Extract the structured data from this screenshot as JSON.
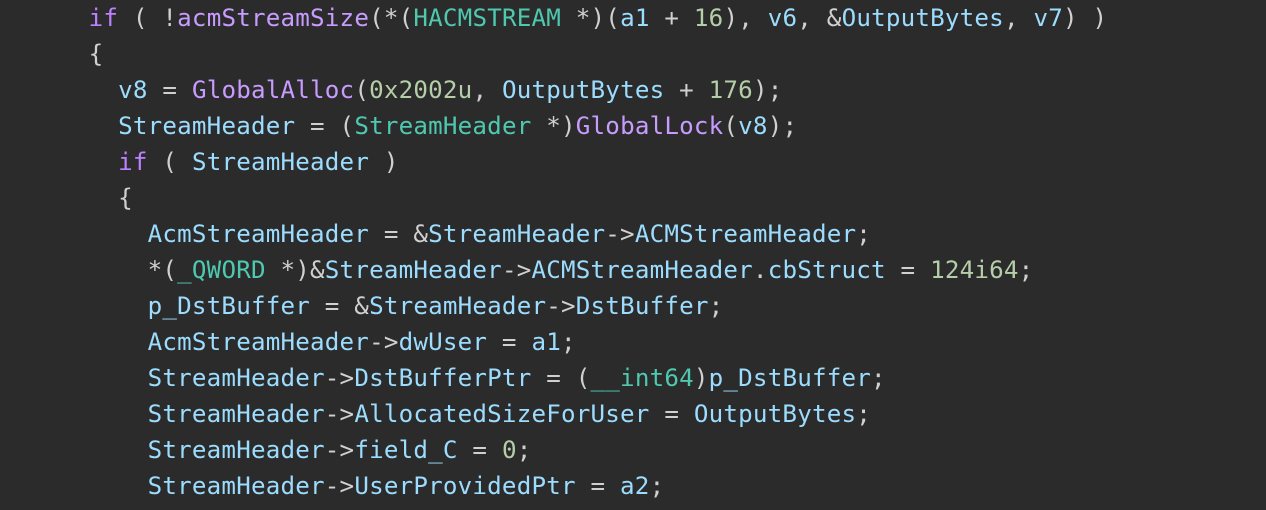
{
  "code": {
    "lines": [
      {
        "indent": 3,
        "tokens": [
          {
            "c": "kw",
            "t": "if"
          },
          {
            "c": "op",
            "t": " ( !"
          },
          {
            "c": "fn",
            "t": "acmStreamSize"
          },
          {
            "c": "op",
            "t": "(*("
          },
          {
            "c": "type",
            "t": "HACMSTREAM"
          },
          {
            "c": "op",
            "t": " *)("
          },
          {
            "c": "var",
            "t": "a1"
          },
          {
            "c": "op",
            "t": " + "
          },
          {
            "c": "num",
            "t": "16"
          },
          {
            "c": "op",
            "t": "), "
          },
          {
            "c": "var",
            "t": "v6"
          },
          {
            "c": "op",
            "t": ", &"
          },
          {
            "c": "var",
            "t": "OutputBytes"
          },
          {
            "c": "op",
            "t": ", "
          },
          {
            "c": "var",
            "t": "v7"
          },
          {
            "c": "op",
            "t": ") )"
          }
        ]
      },
      {
        "indent": 3,
        "tokens": [
          {
            "c": "op",
            "t": "{"
          }
        ]
      },
      {
        "indent": 4,
        "tokens": [
          {
            "c": "var",
            "t": "v8"
          },
          {
            "c": "op",
            "t": " = "
          },
          {
            "c": "fn",
            "t": "GlobalAlloc"
          },
          {
            "c": "op",
            "t": "("
          },
          {
            "c": "num",
            "t": "0x2002u"
          },
          {
            "c": "op",
            "t": ", "
          },
          {
            "c": "var",
            "t": "OutputBytes"
          },
          {
            "c": "op",
            "t": " + "
          },
          {
            "c": "num",
            "t": "176"
          },
          {
            "c": "op",
            "t": ");"
          }
        ]
      },
      {
        "indent": 4,
        "tokens": [
          {
            "c": "var",
            "t": "StreamHeader"
          },
          {
            "c": "op",
            "t": " = ("
          },
          {
            "c": "type",
            "t": "StreamHeader"
          },
          {
            "c": "op",
            "t": " *)"
          },
          {
            "c": "fn",
            "t": "GlobalLock"
          },
          {
            "c": "op",
            "t": "("
          },
          {
            "c": "var",
            "t": "v8"
          },
          {
            "c": "op",
            "t": ");"
          }
        ]
      },
      {
        "indent": 4,
        "tokens": [
          {
            "c": "kw",
            "t": "if"
          },
          {
            "c": "op",
            "t": " ( "
          },
          {
            "c": "var",
            "t": "StreamHeader"
          },
          {
            "c": "op",
            "t": " )"
          }
        ]
      },
      {
        "indent": 4,
        "tokens": [
          {
            "c": "op",
            "t": "{"
          }
        ]
      },
      {
        "indent": 5,
        "tokens": [
          {
            "c": "var",
            "t": "AcmStreamHeader"
          },
          {
            "c": "op",
            "t": " = &"
          },
          {
            "c": "var",
            "t": "StreamHeader"
          },
          {
            "c": "op",
            "t": "->"
          },
          {
            "c": "var",
            "t": "ACMStreamHeader"
          },
          {
            "c": "op",
            "t": ";"
          }
        ]
      },
      {
        "indent": 5,
        "tokens": [
          {
            "c": "op",
            "t": "*("
          },
          {
            "c": "type",
            "t": "_QWORD"
          },
          {
            "c": "op",
            "t": " *)&"
          },
          {
            "c": "var",
            "t": "StreamHeader"
          },
          {
            "c": "op",
            "t": "->"
          },
          {
            "c": "var",
            "t": "ACMStreamHeader"
          },
          {
            "c": "op",
            "t": "."
          },
          {
            "c": "var",
            "t": "cbStruct"
          },
          {
            "c": "op",
            "t": " = "
          },
          {
            "c": "num",
            "t": "124i64"
          },
          {
            "c": "op",
            "t": ";"
          }
        ]
      },
      {
        "indent": 5,
        "tokens": [
          {
            "c": "var",
            "t": "p_DstBuffer"
          },
          {
            "c": "op",
            "t": " = &"
          },
          {
            "c": "var",
            "t": "StreamHeader"
          },
          {
            "c": "op",
            "t": "->"
          },
          {
            "c": "var",
            "t": "DstBuffer"
          },
          {
            "c": "op",
            "t": ";"
          }
        ]
      },
      {
        "indent": 5,
        "tokens": [
          {
            "c": "var",
            "t": "AcmStreamHeader"
          },
          {
            "c": "op",
            "t": "->"
          },
          {
            "c": "var",
            "t": "dwUser"
          },
          {
            "c": "op",
            "t": " = "
          },
          {
            "c": "var",
            "t": "a1"
          },
          {
            "c": "op",
            "t": ";"
          }
        ]
      },
      {
        "indent": 5,
        "tokens": [
          {
            "c": "var",
            "t": "StreamHeader"
          },
          {
            "c": "op",
            "t": "->"
          },
          {
            "c": "var",
            "t": "DstBufferPtr"
          },
          {
            "c": "op",
            "t": " = ("
          },
          {
            "c": "type",
            "t": "__int64"
          },
          {
            "c": "op",
            "t": ")"
          },
          {
            "c": "var",
            "t": "p_DstBuffer"
          },
          {
            "c": "op",
            "t": ";"
          }
        ]
      },
      {
        "indent": 5,
        "tokens": [
          {
            "c": "var",
            "t": "StreamHeader"
          },
          {
            "c": "op",
            "t": "->"
          },
          {
            "c": "var",
            "t": "AllocatedSizeForUser"
          },
          {
            "c": "op",
            "t": " = "
          },
          {
            "c": "var",
            "t": "OutputBytes"
          },
          {
            "c": "op",
            "t": ";"
          }
        ]
      },
      {
        "indent": 5,
        "tokens": [
          {
            "c": "var",
            "t": "StreamHeader"
          },
          {
            "c": "op",
            "t": "->"
          },
          {
            "c": "var",
            "t": "field_C"
          },
          {
            "c": "op",
            "t": " = "
          },
          {
            "c": "num",
            "t": "0"
          },
          {
            "c": "op",
            "t": ";"
          }
        ]
      },
      {
        "indent": 5,
        "tokens": [
          {
            "c": "var",
            "t": "StreamHeader"
          },
          {
            "c": "op",
            "t": "->"
          },
          {
            "c": "var",
            "t": "UserProvidedPtr"
          },
          {
            "c": "op",
            "t": " = "
          },
          {
            "c": "var",
            "t": "a2"
          },
          {
            "c": "op",
            "t": ";"
          }
        ]
      }
    ]
  },
  "style": {
    "indent_unit": "  "
  }
}
